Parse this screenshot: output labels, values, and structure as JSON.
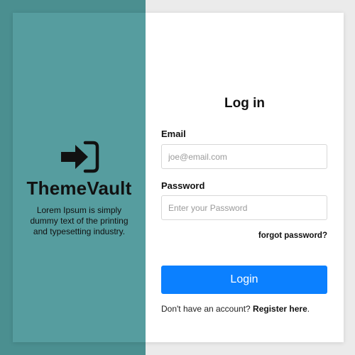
{
  "brand": {
    "name": "ThemeVault",
    "tagline": "Lorem Ipsum is simply dummy text of the printing and typesetting industry.",
    "icon": "sign-in-icon"
  },
  "form": {
    "title": "Log in",
    "email_label": "Email",
    "email_placeholder": "joe@email.com",
    "email_value": "",
    "password_label": "Password",
    "password_placeholder": "Enter your Password",
    "password_value": "",
    "forgot_label": "forgot password?",
    "login_label": "Login",
    "register_prompt": "Don't have an account? ",
    "register_link": "Register here",
    "register_suffix": "."
  },
  "colors": {
    "left_panel": "#569d9f",
    "outer_shade": "#4b8f90",
    "button": "#0b80ff",
    "background": "#ebebeb"
  }
}
